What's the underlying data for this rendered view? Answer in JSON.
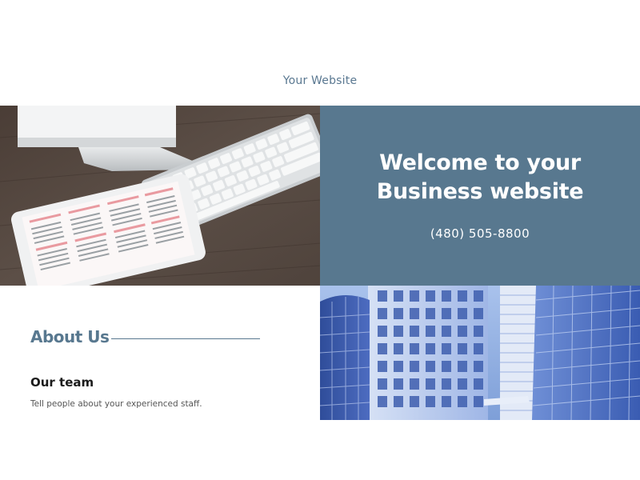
{
  "header": {
    "site_name": "Your Website"
  },
  "hero": {
    "title_line1": "Welcome to your",
    "title_line2": "Business website",
    "phone": "(480) 505-8800",
    "panel_color": "#58788f"
  },
  "about": {
    "heading": "About Us",
    "team_heading": "Our team",
    "team_text": "Tell people about your experienced staff."
  },
  "colors": {
    "accent": "#58788f",
    "background": "#ffffff",
    "desk": "#55473f"
  }
}
